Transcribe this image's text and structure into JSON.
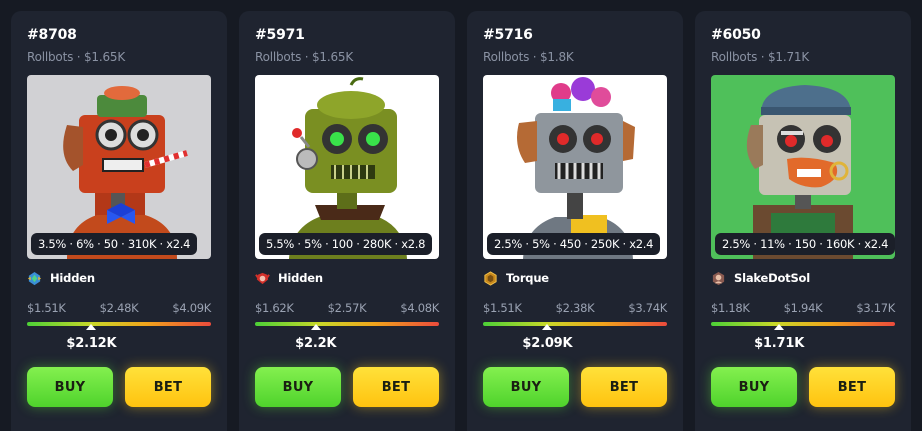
{
  "colors": {
    "page_bg": "#161a23",
    "card_bg": "#1f2430",
    "buy_green": "#5bdc34",
    "bet_yellow": "#ffcf1f"
  },
  "cards": [
    {
      "id": "#8708",
      "collection": "Rollbots · $1.65K",
      "stats": "3.5% · 6% · 50 · 310K · x2.4",
      "owner": "Hidden",
      "owner_icon": "emerald-badge-icon",
      "low": "$1.51K",
      "mid": "$2.48K",
      "high": "$4.09K",
      "price": "$2.12K",
      "price_position_pct": 35,
      "buy_label": "BUY",
      "bet_label": "BET",
      "art_bg": "#d1d1d4",
      "robot_color": "#c9401d"
    },
    {
      "id": "#5971",
      "collection": "Rollbots · $1.65K",
      "stats": "5.5% · 5% · 100 · 280K · x2.8",
      "owner": "Hidden",
      "owner_icon": "red-crest-icon",
      "low": "$1.62K",
      "mid": "$2.57K",
      "high": "$4.08K",
      "price": "$2.2K",
      "price_position_pct": 33,
      "buy_label": "BUY",
      "bet_label": "BET",
      "art_bg": "#ffffff",
      "robot_color": "#7a8f22"
    },
    {
      "id": "#5716",
      "collection": "Rollbots · $1.8K",
      "stats": "2.5% · 5% · 450 · 250K · x2.4",
      "owner": "Torque",
      "owner_icon": "gold-hexagon-icon",
      "low": "$1.51K",
      "mid": "$2.38K",
      "high": "$3.74K",
      "price": "$2.09K",
      "price_position_pct": 35,
      "buy_label": "BUY",
      "bet_label": "BET",
      "art_bg": "#ffffff",
      "robot_color": "#8f969d"
    },
    {
      "id": "#6050",
      "collection": "Rollbots · $1.71K",
      "stats": "2.5% · 11% · 150 · 160K · x2.4",
      "owner": "SlakeDotSol",
      "owner_icon": "user-avatar-icon",
      "low": "$1.18K",
      "mid": "$1.94K",
      "high": "$3.17K",
      "price": "$1.71K",
      "price_position_pct": 37,
      "buy_label": "BUY",
      "bet_label": "BET",
      "art_bg": "#4fc05a",
      "robot_color": "#c6c2b4"
    }
  ]
}
